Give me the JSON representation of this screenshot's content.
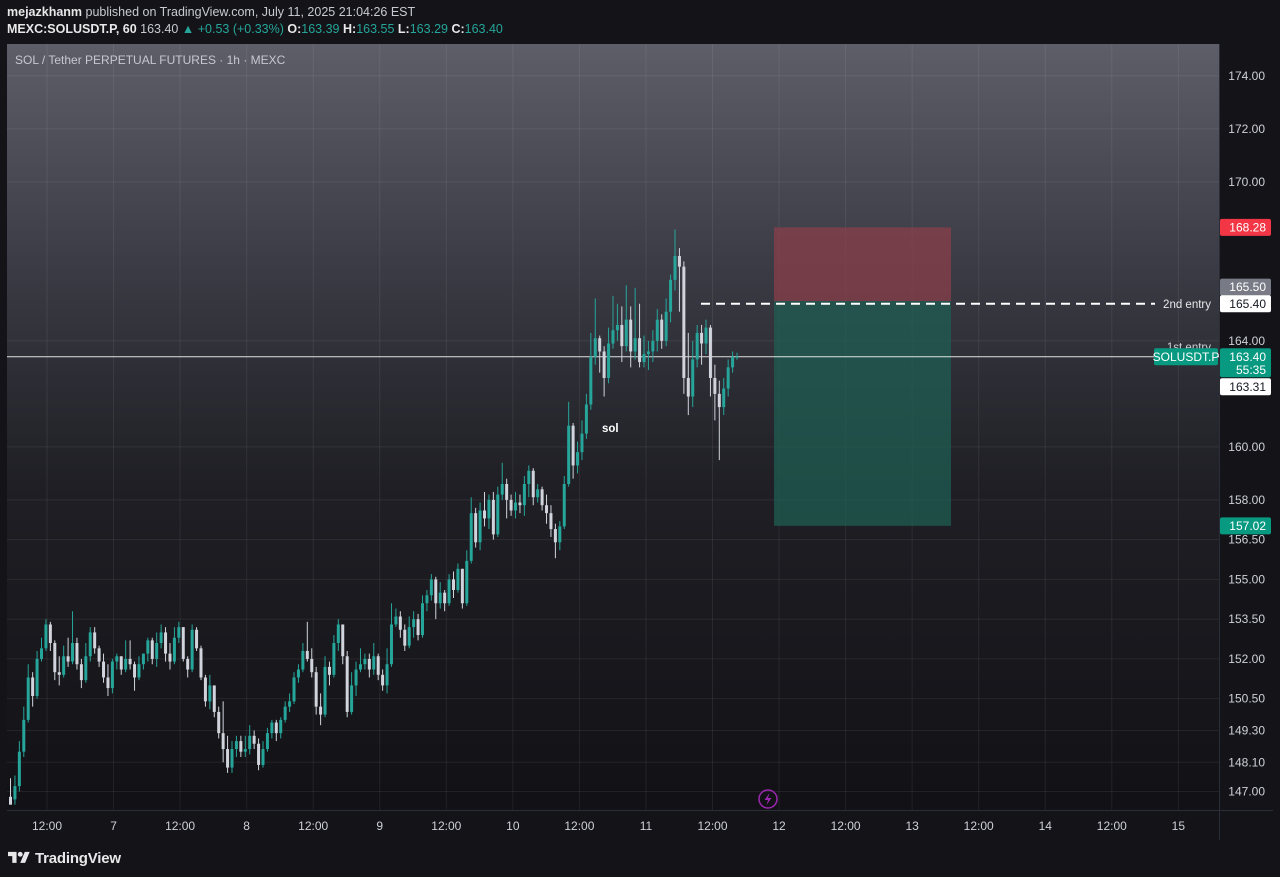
{
  "header": {
    "author": "mejazkhanm",
    "published_text": "published on TradingView.com, July 11, 2025 21:04:26 EST",
    "symbol": "MEXC:SOLUSDT.P, 60",
    "last": "163.40",
    "change_arrow": "▲",
    "change": "+0.53 (+0.33%)",
    "o_label": "O:",
    "o_value": "163.39",
    "h_label": "H:",
    "h_value": "163.55",
    "l_label": "L:",
    "l_value": "163.29",
    "c_label": "C:",
    "c_value": "163.40"
  },
  "pane": {
    "title_prefix": "SOL / Tether ",
    "title_bold": "PERPETUAL FUTURES",
    "title_suffix": " · 1h · MEXC"
  },
  "footer": {
    "logo_text": "TradingView",
    "logo_icon": "tradingview-logo-icon"
  },
  "colors": {
    "up": "#26a69a",
    "down": "#d1d4dc",
    "stop_zone": "#8a3f4a",
    "target_zone": "#1f5d53",
    "stop_tag": "#f23645",
    "target_tag": "#089981",
    "last_tag": "#089981"
  },
  "chart_data": {
    "type": "candlestick",
    "symbol": "SOLUSDT.P",
    "interval": "1h",
    "x_ticks": [
      "12:00",
      "7",
      "12:00",
      "8",
      "12:00",
      "9",
      "12:00",
      "10",
      "12:00",
      "11",
      "12:00",
      "12",
      "12:00",
      "13",
      "12:00",
      "14",
      "12:00",
      "15"
    ],
    "y_ticks": [
      "174.00",
      "172.00",
      "170.00",
      "164.00",
      "160.00",
      "158.00",
      "156.50",
      "155.00",
      "153.50",
      "152.00",
      "150.50",
      "149.30",
      "148.10",
      "147.00"
    ],
    "ylim": [
      146.3,
      175.2
    ],
    "candles": [
      [
        146.8,
        146.5,
        147.5,
        146.7
      ],
      [
        146.7,
        147.2,
        147.6,
        146.5
      ],
      [
        147.2,
        148.5,
        148.9,
        147.0
      ],
      [
        148.5,
        149.7,
        150.2,
        148.3
      ],
      [
        149.7,
        151.3,
        151.8,
        149.6
      ],
      [
        151.3,
        150.6,
        151.5,
        150.2
      ],
      [
        150.6,
        152.0,
        152.3,
        150.5
      ],
      [
        152.0,
        152.4,
        152.8,
        151.9
      ],
      [
        152.4,
        153.3,
        153.5,
        152.3
      ],
      [
        153.3,
        152.6,
        153.4,
        152.3
      ],
      [
        152.6,
        151.5,
        152.7,
        151.2
      ],
      [
        151.5,
        151.4,
        152.1,
        151.0
      ],
      [
        151.4,
        152.1,
        152.5,
        151.3
      ],
      [
        152.1,
        151.9,
        152.8,
        151.7
      ],
      [
        151.9,
        152.6,
        153.8,
        151.8
      ],
      [
        152.6,
        151.8,
        152.8,
        151.6
      ],
      [
        151.8,
        151.2,
        152.0,
        150.9
      ],
      [
        151.2,
        152.1,
        152.6,
        151.1
      ],
      [
        152.1,
        153.0,
        153.2,
        151.9
      ],
      [
        153.0,
        152.4,
        153.2,
        152.2
      ],
      [
        152.4,
        151.9,
        152.5,
        151.7
      ],
      [
        151.9,
        151.3,
        152.2,
        151.1
      ],
      [
        151.3,
        150.9,
        151.8,
        150.6
      ],
      [
        150.9,
        151.9,
        152.0,
        150.7
      ],
      [
        151.9,
        152.1,
        152.2,
        151.6
      ],
      [
        152.1,
        151.6,
        152.1,
        151.4
      ],
      [
        151.6,
        152.0,
        152.7,
        151.5
      ],
      [
        152.0,
        151.8,
        152.7,
        151.6
      ],
      [
        151.8,
        151.3,
        151.9,
        150.8
      ],
      [
        151.3,
        151.8,
        152.1,
        151.2
      ],
      [
        151.8,
        152.2,
        152.2,
        151.6
      ],
      [
        152.2,
        152.7,
        152.8,
        151.9
      ],
      [
        152.7,
        152.0,
        152.8,
        151.8
      ],
      [
        152.0,
        152.6,
        153.0,
        151.7
      ],
      [
        152.6,
        153.0,
        153.3,
        152.4
      ],
      [
        153.0,
        152.2,
        153.2,
        151.9
      ],
      [
        152.2,
        151.9,
        152.6,
        151.6
      ],
      [
        151.9,
        152.8,
        153.2,
        151.8
      ],
      [
        152.8,
        153.2,
        153.4,
        152.6
      ],
      [
        153.2,
        152.0,
        153.2,
        151.9
      ],
      [
        152.0,
        151.6,
        152.1,
        151.3
      ],
      [
        151.6,
        153.1,
        153.3,
        151.5
      ],
      [
        153.1,
        152.4,
        153.2,
        152.3
      ],
      [
        152.4,
        151.3,
        152.5,
        151.2
      ],
      [
        151.3,
        150.4,
        151.4,
        150.2
      ],
      [
        150.4,
        151.0,
        151.4,
        150.1
      ],
      [
        151.0,
        150.0,
        151.0,
        149.8
      ],
      [
        150.0,
        149.2,
        150.2,
        149.0
      ],
      [
        149.2,
        148.6,
        150.4,
        148.1
      ],
      [
        148.6,
        147.9,
        149.1,
        147.7
      ],
      [
        147.9,
        148.6,
        148.9,
        147.7
      ],
      [
        148.6,
        148.9,
        149.1,
        148.3
      ],
      [
        148.9,
        148.5,
        149.1,
        148.3
      ],
      [
        148.5,
        148.6,
        149.1,
        148.3
      ],
      [
        148.6,
        149.1,
        149.5,
        148.4
      ],
      [
        149.1,
        148.8,
        149.3,
        148.6
      ],
      [
        148.8,
        148.0,
        149.0,
        147.8
      ],
      [
        148.0,
        148.6,
        148.9,
        147.9
      ],
      [
        148.6,
        149.2,
        149.4,
        148.5
      ],
      [
        149.2,
        149.6,
        149.7,
        149.0
      ],
      [
        149.6,
        149.2,
        149.7,
        148.9
      ],
      [
        149.2,
        149.7,
        149.8,
        149.0
      ],
      [
        149.7,
        150.2,
        150.4,
        149.6
      ],
      [
        150.2,
        150.4,
        150.7,
        150.0
      ],
      [
        150.4,
        151.3,
        151.5,
        150.3
      ],
      [
        151.3,
        151.6,
        151.8,
        151.1
      ],
      [
        151.6,
        152.3,
        152.6,
        151.5
      ],
      [
        152.3,
        152.0,
        153.4,
        151.9
      ],
      [
        152.0,
        151.5,
        152.4,
        151.3
      ],
      [
        151.5,
        150.2,
        151.7,
        149.9
      ],
      [
        150.2,
        149.9,
        150.7,
        149.5
      ],
      [
        149.9,
        151.7,
        152.1,
        149.8
      ],
      [
        151.7,
        151.4,
        151.9,
        151.0
      ],
      [
        151.4,
        152.6,
        152.9,
        151.3
      ],
      [
        152.6,
        153.3,
        153.5,
        152.3
      ],
      [
        153.3,
        152.1,
        153.3,
        151.8
      ],
      [
        152.1,
        150.0,
        152.3,
        149.8
      ],
      [
        150.0,
        151.0,
        151.5,
        149.9
      ],
      [
        151.0,
        151.6,
        151.9,
        150.6
      ],
      [
        151.6,
        151.8,
        152.4,
        151.5
      ],
      [
        151.8,
        152.0,
        152.2,
        151.6
      ],
      [
        152.0,
        151.6,
        152.2,
        151.3
      ],
      [
        151.6,
        152.1,
        152.6,
        151.4
      ],
      [
        152.1,
        151.4,
        152.2,
        151.2
      ],
      [
        151.4,
        151.0,
        151.6,
        150.8
      ],
      [
        151.0,
        151.8,
        152.4,
        150.7
      ],
      [
        151.8,
        153.3,
        154.1,
        151.7
      ],
      [
        153.3,
        153.6,
        153.9,
        153.2
      ],
      [
        153.6,
        153.1,
        153.8,
        152.8
      ],
      [
        153.1,
        152.5,
        153.3,
        152.3
      ],
      [
        152.5,
        153.2,
        153.6,
        152.4
      ],
      [
        153.2,
        153.5,
        153.8,
        152.8
      ],
      [
        153.5,
        152.9,
        153.7,
        152.7
      ],
      [
        152.9,
        154.1,
        154.4,
        152.8
      ],
      [
        154.1,
        154.4,
        154.6,
        153.8
      ],
      [
        154.4,
        155.0,
        155.2,
        154.2
      ],
      [
        155.0,
        154.1,
        155.1,
        153.5
      ],
      [
        154.1,
        154.5,
        154.9,
        153.9
      ],
      [
        154.5,
        154.1,
        154.6,
        153.8
      ],
      [
        154.1,
        155.0,
        155.2,
        154.0
      ],
      [
        155.0,
        154.6,
        155.3,
        154.3
      ],
      [
        154.6,
        155.4,
        155.6,
        154.5
      ],
      [
        155.4,
        154.1,
        155.4,
        153.9
      ],
      [
        154.1,
        155.7,
        156.1,
        154.0
      ],
      [
        155.7,
        157.5,
        158.1,
        155.6
      ],
      [
        157.5,
        156.4,
        157.7,
        156.2
      ],
      [
        156.4,
        157.6,
        157.9,
        156.1
      ],
      [
        157.6,
        157.3,
        158.3,
        157.0
      ],
      [
        157.3,
        158.0,
        158.2,
        156.9
      ],
      [
        158.0,
        156.7,
        158.3,
        156.5
      ],
      [
        156.7,
        158.2,
        158.5,
        156.6
      ],
      [
        158.2,
        158.6,
        159.4,
        158.0
      ],
      [
        158.6,
        158.0,
        158.8,
        157.3
      ],
      [
        158.0,
        157.6,
        158.2,
        157.4
      ],
      [
        157.6,
        157.9,
        158.3,
        157.3
      ],
      [
        157.9,
        157.8,
        158.2,
        157.5
      ],
      [
        157.8,
        158.6,
        158.9,
        157.4
      ],
      [
        158.6,
        159.1,
        159.3,
        158.1
      ],
      [
        159.1,
        158.1,
        159.2,
        157.8
      ],
      [
        158.1,
        158.4,
        158.6,
        157.9
      ],
      [
        158.4,
        157.8,
        158.5,
        157.6
      ],
      [
        157.8,
        157.5,
        158.2,
        157.1
      ],
      [
        157.5,
        156.9,
        157.8,
        156.6
      ],
      [
        156.9,
        156.4,
        157.1,
        155.8
      ],
      [
        156.4,
        157.0,
        157.2,
        156.1
      ],
      [
        157.0,
        158.6,
        158.9,
        156.9
      ],
      [
        158.6,
        160.8,
        161.7,
        158.5
      ],
      [
        160.8,
        159.3,
        160.9,
        158.8
      ],
      [
        159.3,
        159.8,
        160.2,
        159.0
      ],
      [
        159.8,
        160.5,
        161.0,
        159.5
      ],
      [
        160.5,
        161.6,
        162.0,
        160.3
      ],
      [
        161.6,
        163.4,
        164.3,
        161.4
      ],
      [
        163.4,
        164.1,
        165.6,
        163.1
      ],
      [
        164.1,
        163.6,
        164.2,
        162.8
      ],
      [
        163.6,
        162.6,
        163.8,
        161.9
      ],
      [
        162.6,
        163.9,
        164.5,
        162.4
      ],
      [
        163.9,
        164.4,
        165.7,
        163.7
      ],
      [
        164.4,
        164.6,
        165.4,
        164.0
      ],
      [
        164.6,
        163.8,
        165.3,
        163.2
      ],
      [
        163.8,
        164.8,
        166.1,
        163.6
      ],
      [
        164.8,
        163.6,
        165.3,
        163.0
      ],
      [
        163.6,
        164.1,
        166.0,
        163.3
      ],
      [
        164.1,
        163.2,
        165.4,
        163.0
      ],
      [
        163.2,
        163.5,
        164.2,
        163.0
      ],
      [
        163.5,
        163.6,
        164.0,
        162.9
      ],
      [
        163.6,
        164.0,
        164.4,
        163.2
      ],
      [
        164.0,
        164.8,
        165.2,
        163.6
      ],
      [
        164.8,
        164.0,
        165.0,
        163.7
      ],
      [
        164.0,
        165.1,
        165.6,
        163.8
      ],
      [
        165.1,
        166.3,
        166.5,
        164.7
      ],
      [
        166.3,
        167.2,
        168.2,
        165.9
      ],
      [
        167.2,
        166.8,
        167.5,
        165.1
      ],
      [
        166.8,
        162.6,
        167.0,
        162.0
      ],
      [
        162.6,
        161.9,
        164.3,
        161.2
      ],
      [
        161.9,
        163.3,
        164.0,
        161.5
      ],
      [
        163.3,
        164.3,
        164.6,
        163.0
      ],
      [
        164.3,
        163.9,
        164.6,
        163.1
      ],
      [
        163.9,
        164.5,
        164.8,
        163.5
      ],
      [
        164.5,
        162.6,
        164.6,
        161.9
      ],
      [
        162.6,
        162.0,
        163.1,
        161.0
      ],
      [
        162.0,
        161.5,
        162.5,
        159.5
      ],
      [
        161.5,
        162.2,
        162.6,
        161.2
      ],
      [
        162.2,
        163.0,
        163.3,
        161.9
      ],
      [
        163.0,
        163.4,
        163.6,
        162.8
      ],
      [
        163.39,
        163.4,
        163.55,
        163.29
      ]
    ],
    "position": {
      "stop_price": 168.28,
      "entry_price": 165.5,
      "target_price": 157.02
    },
    "second_entry": {
      "label": "2nd entry",
      "price": 165.4
    },
    "first_entry_label": "1st entry",
    "text_note": "sol",
    "last_price": {
      "symbol": "SOLUSDT.P",
      "price": "163.40",
      "countdown": "55:35",
      "extra": "163.31"
    },
    "tags": {
      "stop": "168.28",
      "entry": "165.50",
      "second_entry": "165.40",
      "target": "157.02"
    }
  }
}
